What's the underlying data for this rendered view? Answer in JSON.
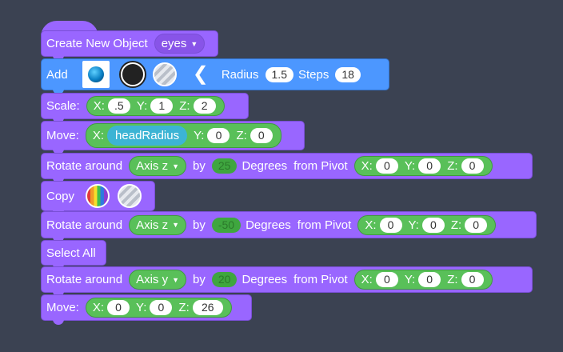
{
  "blocks": {
    "create": {
      "label": "Create New Object",
      "dropdown": "eyes"
    },
    "add": {
      "label": "Add",
      "radius_label": "Radius",
      "radius": "1.5",
      "steps_label": "Steps",
      "steps": "18"
    },
    "scale": {
      "label": "Scale:",
      "x_label": "X:",
      "x": ".5",
      "y_label": "Y:",
      "y": "1",
      "z_label": "Z:",
      "z": "2"
    },
    "move1": {
      "label": "Move:",
      "x_label": "X:",
      "x_reporter": "headRadius",
      "y_label": "Y:",
      "y": "0",
      "z_label": "Z:",
      "z": "0"
    },
    "rotate1": {
      "label": "Rotate around",
      "axis": "Axis z",
      "by": "by",
      "degrees": "25",
      "degrees_label": "Degrees",
      "pivot_label": "from Pivot",
      "x_label": "X:",
      "x": "0",
      "y_label": "Y:",
      "y": "0",
      "z_label": "Z:",
      "z": "0"
    },
    "copy": {
      "label": "Copy"
    },
    "rotate2": {
      "label": "Rotate around",
      "axis": "Axis z",
      "by": "by",
      "degrees": "-50",
      "degrees_label": "Degrees",
      "pivot_label": "from Pivot",
      "x_label": "X:",
      "x": "0",
      "y_label": "Y:",
      "y": "0",
      "z_label": "Z:",
      "z": "0"
    },
    "selectall": {
      "label": "Select All"
    },
    "rotate3": {
      "label": "Rotate around",
      "axis": "Axis y",
      "by": "by",
      "degrees": "20",
      "degrees_label": "Degrees",
      "pivot_label": "from Pivot",
      "x_label": "X:",
      "x": "0",
      "y_label": "Y:",
      "y": "0",
      "z_label": "Z:",
      "z": "0"
    },
    "move2": {
      "label": "Move:",
      "x_label": "X:",
      "x": "0",
      "y_label": "Y:",
      "y": "0",
      "z_label": "Z:",
      "z": "26"
    }
  },
  "icons": {
    "dropdown": "caret-down-icon",
    "back": "chevron-left-icon"
  },
  "colors": {
    "background": "#3b4252",
    "motion": "#9966ff",
    "add": "#4c97ff",
    "field_group": "#59c059",
    "reporter": "#3cb4d4"
  }
}
